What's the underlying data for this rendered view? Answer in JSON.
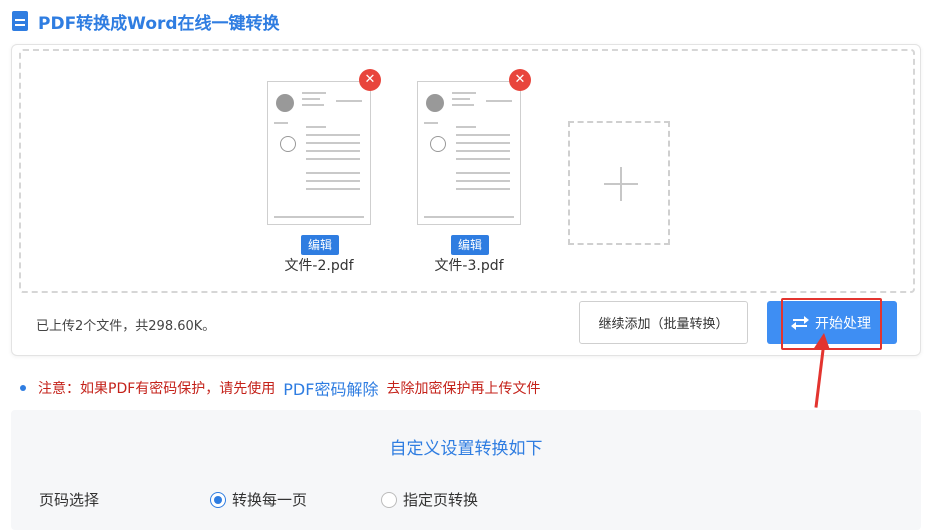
{
  "header": {
    "title": "PDF转换成Word在线一键转换"
  },
  "files": [
    {
      "name": "文件-2.pdf",
      "edit_label": "编辑",
      "delete_symbol": "✕"
    },
    {
      "name": "文件-3.pdf",
      "edit_label": "编辑",
      "delete_symbol": "✕"
    }
  ],
  "upload": {
    "info": "已上传2个文件，共298.60K。",
    "continue_label": "继续添加（批量转换）",
    "start_label": "开始处理"
  },
  "notice": {
    "prefix": "注意：如果PDF有密码保护，请先使用",
    "link": "PDF密码解除",
    "suffix": "去除加密保护再上传文件"
  },
  "settings": {
    "title": "自定义设置转换如下",
    "page_label": "页码选择",
    "options": [
      {
        "label": "转换每一页",
        "selected": true
      },
      {
        "label": "指定页转换",
        "selected": false
      }
    ]
  },
  "colors": {
    "accent": "#2f7de1",
    "danger": "#e3342f",
    "button": "#3e8ef3"
  }
}
